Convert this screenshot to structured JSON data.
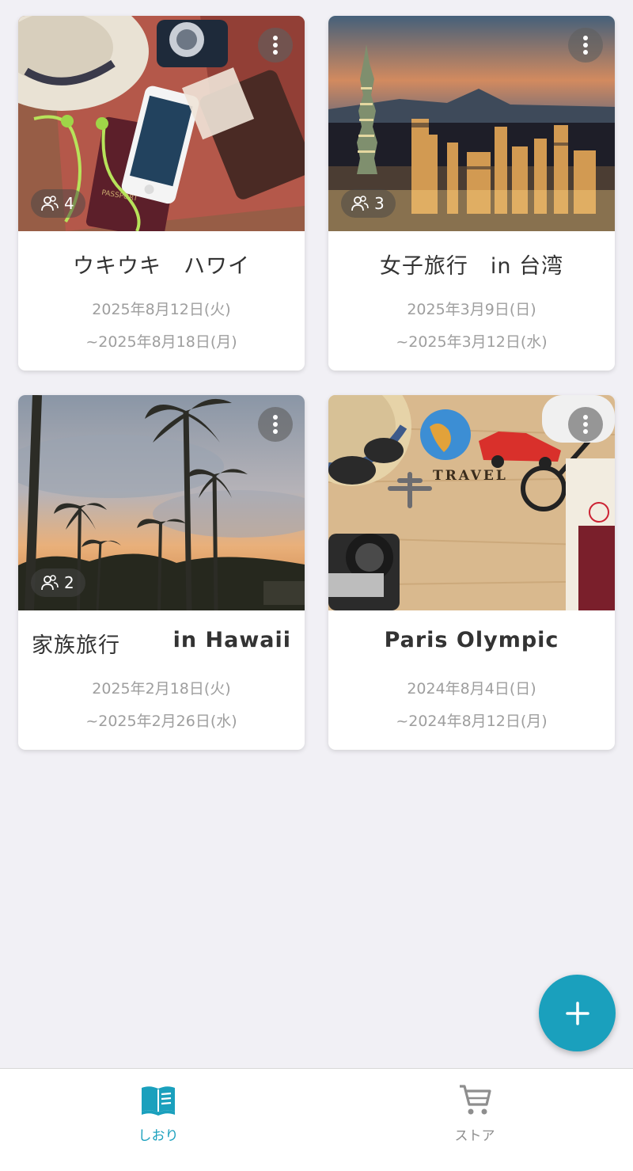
{
  "trips": [
    {
      "title": "ウキウキ　ハワイ",
      "title_left": "",
      "title_right": "",
      "members": "4",
      "start": "2025年8月12日(火)",
      "end": "~2025年8月18日(月)"
    },
    {
      "title": "女子旅行　in 台湾",
      "title_left": "",
      "title_right": "",
      "members": "3",
      "start": "2025年3月9日(日)",
      "end": "~2025年3月12日(水)"
    },
    {
      "title": "",
      "title_left": "家族旅行",
      "title_right": "in Hawaii",
      "members": "2",
      "start": "2025年2月18日(火)",
      "end": "~2025年2月26日(水)"
    },
    {
      "title": "Paris Olympic",
      "title_left": "",
      "title_right": "",
      "members": "",
      "start": "2024年8月4日(日)",
      "end": "~2024年8月12日(月)"
    }
  ],
  "images": {
    "travel_bag_word": "PASSPORT",
    "travel_board_word": "TRAVEL"
  },
  "icons": {
    "more": "more-vertical-icon",
    "members": "people-icon",
    "add": "plus-icon",
    "shiori": "book-icon",
    "store": "cart-icon"
  },
  "nav": {
    "items": [
      {
        "label": "しおり",
        "active": true
      },
      {
        "label": "ストア",
        "active": false
      }
    ]
  },
  "colors": {
    "accent": "#1aa0bd",
    "inactive": "#8e8e8e",
    "background": "#f1f0f5"
  }
}
